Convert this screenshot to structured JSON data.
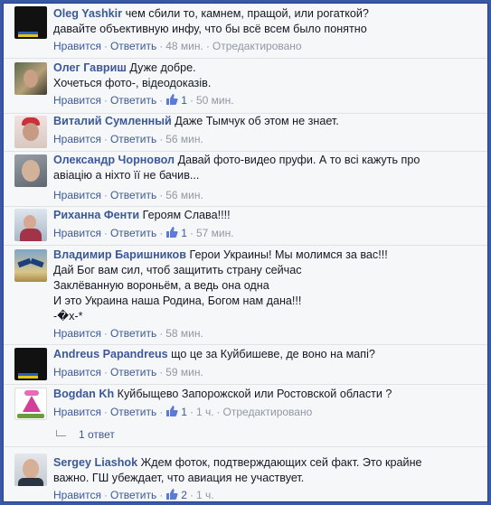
{
  "ui": {
    "like": "Нравится",
    "reply": "Ответить",
    "sep": "·",
    "edited": "Отредактировано"
  },
  "comments": [
    {
      "author": "Oleg Yashkir",
      "lines": [
        "чем сбили то, камнем, пращой, или рогаткой?",
        "давайте объективную инфу, что бы всё всем было понятно"
      ],
      "time": "48 мин.",
      "likes": "",
      "edited": true,
      "avatar": "flag-avatar"
    },
    {
      "author": "Олег Гавриш",
      "lines": [
        "Дуже добре.",
        "Хочеться фото-, відеодоказів."
      ],
      "time": "50 мин.",
      "likes": "1",
      "avatar": "person-avatar"
    },
    {
      "author": "Виталий Сумленный",
      "lines": [
        "Даже Тымчук об этом не знает."
      ],
      "time": "56 мин.",
      "likes": "",
      "avatar": "person-avatar"
    },
    {
      "author": "Олександр Чорновол",
      "lines": [
        "Давай фото-видео пруфи. А то всі кажуть про",
        "авіацію а ніхто її не бачив..."
      ],
      "time": "56 мин.",
      "likes": "",
      "avatar": "person-avatar"
    },
    {
      "author": "Риханна Фенти",
      "lines": [
        "Героям Слава!!!!"
      ],
      "time": "57 мин.",
      "likes": "1",
      "avatar": "person-avatar"
    },
    {
      "author": "Владимир Баришников",
      "lines": [
        "Герои Украины! Мы молимся за вас!!!",
        "Дай Бог вам сил, чтоб защитить страну сейчас",
        "Заклёванную вороньём, а ведь она одна",
        "И это Украина наша Родина, Богом нам дана!!!",
        "-�х-*"
      ],
      "time": "58 мин.",
      "likes": "",
      "avatar": "eagle-avatar"
    },
    {
      "author": "Andreus Papandreus",
      "lines": [
        "що це за Куйбишеве, де воно на мапі?"
      ],
      "time": "59 мин.",
      "likes": "",
      "avatar": "flag-avatar"
    },
    {
      "author": "Bogdan Kh",
      "lines": [
        "Куйбыщево Запорожской или Ростовской области ?"
      ],
      "time": "1 ч.",
      "likes": "1",
      "edited": true,
      "replies": "1 ответ",
      "avatar": "pink-logo-avatar"
    },
    {
      "author": "Sergey Liashok",
      "lines": [
        "Ждем фоток, подтверждающих сей факт. Это крайне",
        "важно. ГШ убеждает, что авиация не участвует."
      ],
      "time": "1 ч.",
      "likes": "2",
      "avatar": "person-avatar"
    }
  ],
  "colors": {
    "link": "#3b5998",
    "meta": "#9197a3",
    "frame": "#3b58a6",
    "background": "#f6f7f9"
  }
}
